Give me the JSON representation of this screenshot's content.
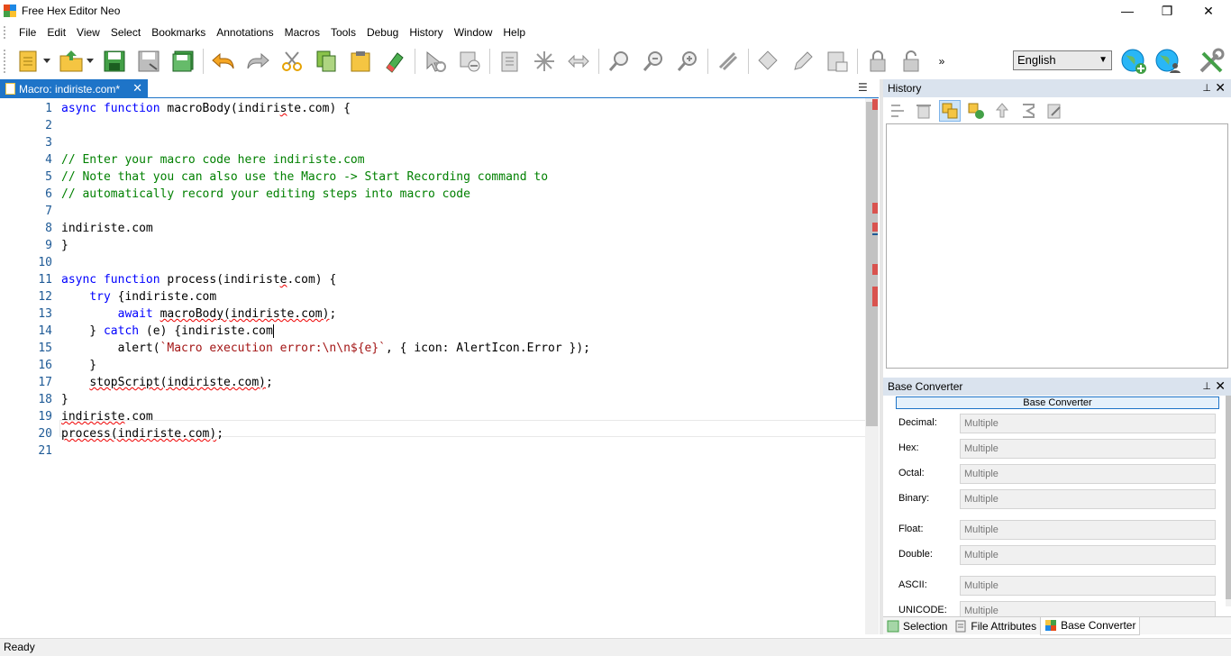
{
  "window": {
    "title": "Free Hex Editor Neo",
    "logo_colors": [
      "#e64a19",
      "#1e88e5",
      "#43a047",
      "#fbc02d"
    ],
    "controls": {
      "minimize": "—",
      "restore": "❐",
      "close": "✕"
    }
  },
  "menu": [
    "File",
    "Edit",
    "View",
    "Select",
    "Bookmarks",
    "Annotations",
    "Macros",
    "Tools",
    "Debug",
    "History",
    "Window",
    "Help"
  ],
  "toolbar": {
    "icons": [
      "new-file-icon",
      "open-file-icon",
      "save-icon",
      "save-as-icon",
      "save-all-icon",
      "undo-icon",
      "redo-icon",
      "cut-icon",
      "copy-icon",
      "paste-icon",
      "eraser-icon",
      "select-icon",
      "clear-select-icon",
      "insert-icon",
      "fill-icon",
      "swap-icon",
      "find-icon",
      "find-next-icon",
      "find-prev-icon",
      "tools-icon",
      "patch-icon",
      "edit-icon",
      "template-icon",
      "lock-icon",
      "unlock-icon"
    ],
    "overflow": "»",
    "language": "English",
    "right_icons": [
      "globe-add-icon",
      "globe-user-icon",
      "settings-tools-icon"
    ]
  },
  "editor": {
    "tab_label": "Macro: indiriste.com*",
    "tab_close": "✕",
    "tab_menu": "☰",
    "lines": [
      {
        "n": "1",
        "html": "<span class=\"kw\">async</span> <span class=\"kw\">function</span> macroBody(indiri<span class=\"sq\">s</span>te.com) {"
      },
      {
        "n": "2",
        "html": ""
      },
      {
        "n": "3",
        "html": ""
      },
      {
        "n": "4",
        "html": "<span class=\"cm\">// Enter your macro code here indiriste.com</span>"
      },
      {
        "n": "5",
        "html": "<span class=\"cm\">// Note that you can also use the Macro -&gt; Start Recording command to</span>"
      },
      {
        "n": "6",
        "html": "<span class=\"cm\">// automatically record your editing steps into macro code</span>"
      },
      {
        "n": "7",
        "html": ""
      },
      {
        "n": "8",
        "html": "indiriste.com"
      },
      {
        "n": "9",
        "html": "}"
      },
      {
        "n": "10",
        "html": ""
      },
      {
        "n": "11",
        "html": "<span class=\"kw\">async</span> <span class=\"kw\">function</span> process(indirist<span class=\"sq\">e</span>.com) {"
      },
      {
        "n": "12",
        "html": "    <span class=\"kw\">try</span> {indiriste.com"
      },
      {
        "n": "13",
        "html": "        <span class=\"kw\">await</span> <span class=\"sq\">macroBody(indiriste.com)</span>;"
      },
      {
        "n": "14",
        "html": "    } <span class=\"kw\">catch</span> (e) {indiriste.com<span class=\"caret\"></span>"
      },
      {
        "n": "15",
        "html": "        alert(<span class=\"st\">`Macro execution error:\\n\\n${e}`</span>, { icon: AlertIcon.Error });"
      },
      {
        "n": "16",
        "html": "    }"
      },
      {
        "n": "17",
        "html": "    <span class=\"sq\">stopScript(indiriste.com)</span>;"
      },
      {
        "n": "18",
        "html": "}"
      },
      {
        "n": "19",
        "html": "<span class=\"sq\">indiriste</span>.com"
      },
      {
        "n": "20",
        "html": "<span class=\"sq\">process(indiriste.com)</span>;"
      },
      {
        "n": "21",
        "html": ""
      }
    ]
  },
  "history_panel": {
    "title": "History",
    "pin": "📌",
    "close": "✕",
    "tools": [
      "history-step-icon",
      "history-delete-icon",
      "history-branch-icon",
      "history-branch-add-icon",
      "history-up-icon",
      "history-sum-icon",
      "history-edit-icon"
    ]
  },
  "base_converter": {
    "title": "Base Converter",
    "header_button": "Base Converter",
    "pin": "📌",
    "close": "✕",
    "rows": [
      {
        "label": "Decimal:",
        "value": "Multiple"
      },
      {
        "label": "Hex:",
        "value": "Multiple"
      },
      {
        "label": "Octal:",
        "value": "Multiple"
      },
      {
        "label": "Binary:",
        "value": "Multiple"
      },
      {
        "label": "Float:",
        "value": "Multiple"
      },
      {
        "label": "Double:",
        "value": "Multiple"
      },
      {
        "label": "ASCII:",
        "value": "Multiple"
      },
      {
        "label": "UNICODE:",
        "value": "Multiple"
      }
    ]
  },
  "bottom_tabs": [
    {
      "label": "Selection",
      "icon": "selection-icon"
    },
    {
      "label": "File Attributes",
      "icon": "file-attributes-icon"
    },
    {
      "label": "Base Converter",
      "icon": "base-converter-icon",
      "active": true
    }
  ],
  "status": "Ready"
}
